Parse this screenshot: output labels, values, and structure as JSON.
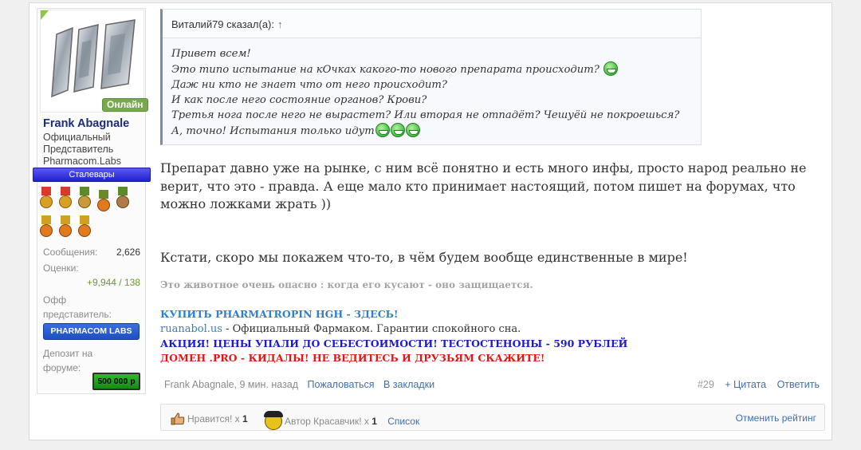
{
  "user": {
    "name": "Frank Abagnale",
    "status_badge": "Онлайн",
    "title_lines": [
      "Официальный",
      "Представитель",
      "Pharmacom.Labs"
    ],
    "banner": "Сталевары",
    "stats": {
      "messages_label": "Сообщения:",
      "messages_value": "2,626",
      "ratings_label": "Оценки:",
      "ratings_value": "+9,944 / 138",
      "rep_label_1": "Офф",
      "rep_label_2": "представитель:",
      "rep_button": "PHARMACOM LABS",
      "deposit_label_1": "Депозит на",
      "deposit_label_2": "форуме:",
      "deposit_value": "500 000 р"
    }
  },
  "quote": {
    "author": "Виталий79 сказал(а):",
    "jump": "↑",
    "lines": [
      "Привет всем!",
      "Это типо испытание на кОчках какого-то нового препарата происходит?",
      "Даж ни кто не знает что от него происходит?",
      "И как после него состояние органов? Крови?",
      "Третья нога после него не вырастет? Или вторая не отпадёт? Чешуёй не покроешься?",
      "А, точно! Испытания только идут"
    ]
  },
  "message": {
    "paragraph1": "Препарат давно уже на рынке, с ним всё понятно и есть много инфы, просто народ реально не верит, что это - правда. А еще мало кто принимает настоящий, потом пишет на форумах, что можно ложками жрать ))",
    "paragraph2": "Кстати, скоро мы покажем что-то, в чём будем вообще единственные в мире!"
  },
  "signature": {
    "quote": "Это животное очень опасно : когда его кусают - оно защищается.",
    "buy_link": "КУПИТЬ PHARMATROPIN HGH - ЗДЕСЬ!",
    "site_link": "ruanabol.us",
    "site_desc": " - Официальный Фармаком. Гарантии спокойного сна.",
    "promo": "АКЦИЯ! ЦЕНЫ УПАЛИ ДО СЕБЕСТОИМОСТИ! ТЕСТОСТЕНОНЫ - 590 РУБЛЕЙ",
    "warning": "ДОМЕН .PRO - КИДАЛЫ! НЕ ВЕДИТЕСЬ И ДРУЗЬЯМ СКАЖИТЕ!",
    "colors": {
      "buy": "#2f7fd0",
      "promo": "#1c1cc8",
      "warning": "#e01818"
    }
  },
  "footer": {
    "author_time": "Frank Abagnale, 9 мин. назад",
    "report": "Пожаловаться",
    "bookmark": "В закладки",
    "post_number": "#29",
    "quote_btn": "+ Цитата",
    "reply_btn": "Ответить"
  },
  "ratings": {
    "like_label": "Нравится!",
    "like_count_prefix": "x",
    "like_count": "1",
    "cool_label": "Автор Красавчик!",
    "cool_count_prefix": "x",
    "cool_count": "1",
    "list_link": "Список",
    "cancel_link": "Отменить рейтинг"
  }
}
